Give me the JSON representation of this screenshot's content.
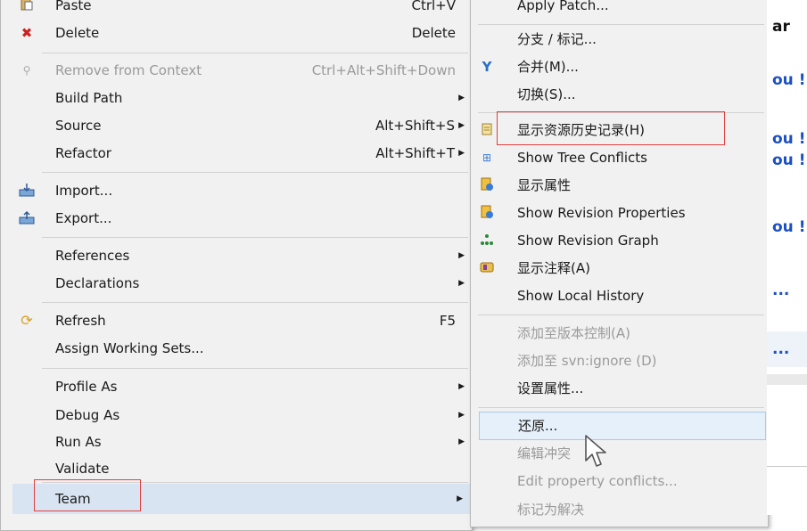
{
  "context_menu": {
    "items": [
      {
        "label": "Paste",
        "accel": "Ctrl+V",
        "icon": "paste-icon"
      },
      {
        "label": "Delete",
        "accel": "Delete",
        "icon": "delete-icon"
      },
      {
        "label": "Remove from Context",
        "accel": "Ctrl+Alt+Shift+Down",
        "icon": "remove-context-icon",
        "disabled": true
      },
      {
        "label": "Build Path",
        "submenu": true
      },
      {
        "label": "Source",
        "accel": "Alt+Shift+S"
      },
      {
        "label": "Refactor",
        "accel": "Alt+Shift+T"
      },
      {
        "label": "Import...",
        "icon": "import-icon"
      },
      {
        "label": "Export...",
        "icon": "export-icon"
      },
      {
        "label": "References",
        "submenu": true
      },
      {
        "label": "Declarations",
        "submenu": true
      },
      {
        "label": "Refresh",
        "accel": "F5",
        "icon": "refresh-icon"
      },
      {
        "label": "Assign Working Sets..."
      },
      {
        "label": "Profile As",
        "submenu": true
      },
      {
        "label": "Debug As",
        "submenu": true
      },
      {
        "label": "Run As",
        "submenu": true
      },
      {
        "label": "Validate"
      },
      {
        "label": "Team",
        "submenu": true
      }
    ]
  },
  "team_menu": {
    "items": [
      {
        "label": "Apply Patch..."
      },
      {
        "label": "分支 / 标记..."
      },
      {
        "label": "合并(M)...",
        "icon": "merge-icon"
      },
      {
        "label": "切换(S)..."
      },
      {
        "label": "显示资源历史记录(H)",
        "icon": "history-icon"
      },
      {
        "label": "Show Tree Conflicts",
        "icon": "tree-conflicts-icon"
      },
      {
        "label": "显示属性",
        "icon": "properties-icon"
      },
      {
        "label": "Show Revision Properties",
        "icon": "revision-properties-icon"
      },
      {
        "label": "Show Revision Graph",
        "icon": "revision-graph-icon"
      },
      {
        "label": "显示注释(A)",
        "icon": "annotate-icon"
      },
      {
        "label": "Show Local History"
      },
      {
        "label": "添加至版本控制(A)",
        "disabled": true
      },
      {
        "label": "添加至 svn:ignore (D)",
        "disabled": true
      },
      {
        "label": "设置属性..."
      },
      {
        "label": "还原..."
      },
      {
        "label": "编辑冲突",
        "disabled": true
      },
      {
        "label": "Edit property conflicts...",
        "disabled": true
      },
      {
        "label": "标记为解决",
        "disabled": true
      }
    ]
  },
  "editor": {
    "lines": [
      "ar",
      "ou !",
      "ou !",
      "ou !",
      "ou !",
      "...",
      "..."
    ]
  },
  "colors": {
    "highlight_box": "#e04040",
    "editor_text_blue": "#1b4fc4"
  }
}
